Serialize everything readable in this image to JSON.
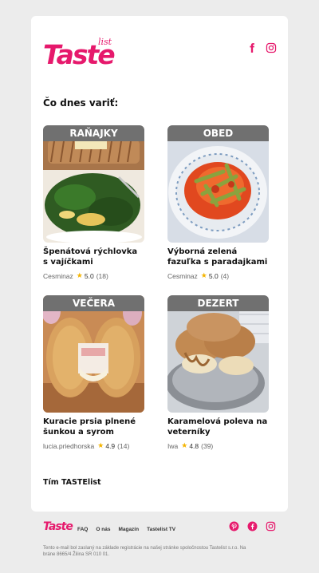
{
  "brand": {
    "logo_word": "Taste",
    "logo_sub": "list",
    "accent": "#e6196c"
  },
  "header": {
    "social_icons": [
      "facebook-icon",
      "instagram-icon"
    ]
  },
  "section_title": "Čo dnes variť:",
  "recipes": [
    {
      "tag": "RAŇAJKY",
      "title": "Špenátová rýchlovka s vajíčkami",
      "author": "Cesminaz",
      "rating": "5.0",
      "count": "(18)"
    },
    {
      "tag": "OBED",
      "title": "Výborná zelená fazuľka s paradajkami",
      "author": "Cesminaz",
      "rating": "5.0",
      "count": "(4)"
    },
    {
      "tag": "VEČERA",
      "title": "Kuracie prsia plnené šunkou a syrom",
      "author": "lucia.priedhorska",
      "rating": "4.9",
      "count": "(14)"
    },
    {
      "tag": "DEZERT",
      "title": "Karamelová poleva na veterníky",
      "author": "Iwa",
      "rating": "4.8",
      "count": "(39)"
    }
  ],
  "signoff": "Tím TASTElist",
  "footer": {
    "logo": "Taste",
    "links": [
      "FAQ",
      "O nás",
      "Magazín",
      "Tastelist TV"
    ],
    "social_icons": [
      "pinterest-icon",
      "facebook-icon",
      "instagram-icon"
    ],
    "disclaimer": "Tento e-mail bol zaslaný na základe registrácie na našej stránke spoločnostou Tastelist s.r.o. Na bráne 8665/4 Žilina SR 010 01."
  },
  "colors": {
    "background": "#ececec",
    "card": "#ffffff",
    "tag_bg": "#707070",
    "star": "#f4b400"
  }
}
